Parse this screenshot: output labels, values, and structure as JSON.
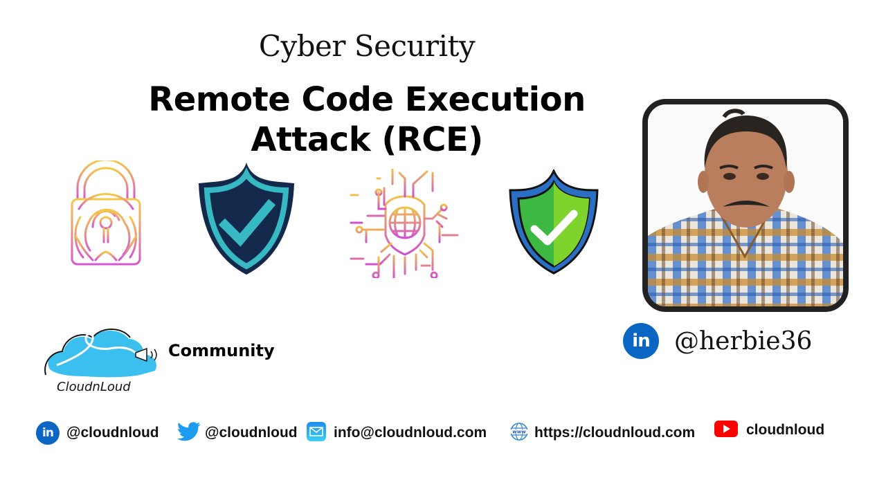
{
  "header": {
    "subtitle": "Cyber Security",
    "title_line1": "Remote Code Execution",
    "title_line2": "Attack (RCE)"
  },
  "illustrations": [
    {
      "name": "fingerprint-lock-icon"
    },
    {
      "name": "shield-check-dark-icon"
    },
    {
      "name": "cyber-globe-shield-icon"
    },
    {
      "name": "shield-check-green-icon"
    }
  ],
  "author": {
    "photo_alt": "Presenter portrait",
    "linkedin_icon_label": "in",
    "handle": "@herbie36"
  },
  "brand": {
    "name": "CloudnLoud",
    "tagline": "Community"
  },
  "footer": {
    "linkedin": {
      "icon_label": "in",
      "text": "@cloudnloud"
    },
    "twitter": {
      "text": "@cloudnloud"
    },
    "email": {
      "text": "info@cloudnloud.com"
    },
    "website": {
      "icon_label": "www",
      "text": "https://cloudnloud.com"
    },
    "youtube": {
      "text": "cloudnloud"
    }
  },
  "colors": {
    "linkedin": "#0a66c2",
    "twitter": "#1d9bf0",
    "youtube": "#ff0000",
    "cloud": "#3bbfef",
    "shield_dark": "#13294b",
    "shield_teal": "#37b9c4",
    "shield_blue": "#2a6fc4",
    "shield_green": "#3db843"
  }
}
